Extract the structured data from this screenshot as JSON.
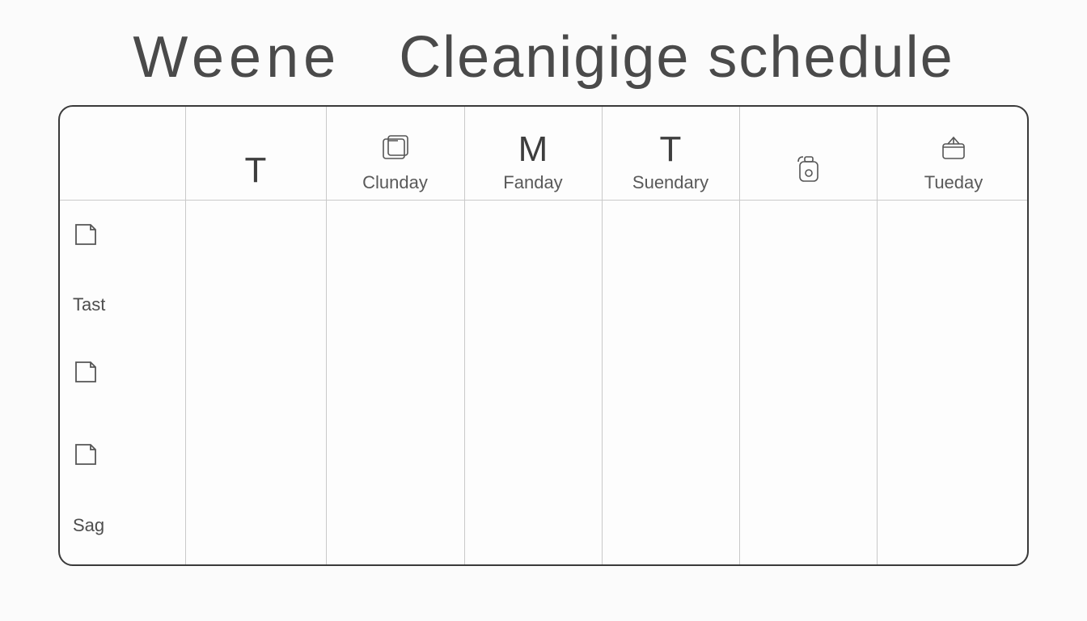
{
  "title": {
    "part1": "Weene",
    "part2": "Cleanigige schedule"
  },
  "columns": [
    {
      "letter": "T",
      "label": ""
    },
    {
      "letter": "",
      "label": "Clunday",
      "icon": "folder"
    },
    {
      "letter": "M",
      "label": "Fanday"
    },
    {
      "letter": "T",
      "label": "Suendary"
    },
    {
      "letter": "",
      "label": "",
      "icon": "jug"
    },
    {
      "letter": "",
      "label": "Tueday",
      "icon": "box"
    }
  ],
  "rows": [
    {
      "label": "",
      "icon": "note"
    },
    {
      "label": "Tast",
      "icon": ""
    },
    {
      "label": "",
      "icon": "note"
    },
    {
      "label": "",
      "icon": "note"
    },
    {
      "label": "Sag",
      "icon": ""
    }
  ]
}
